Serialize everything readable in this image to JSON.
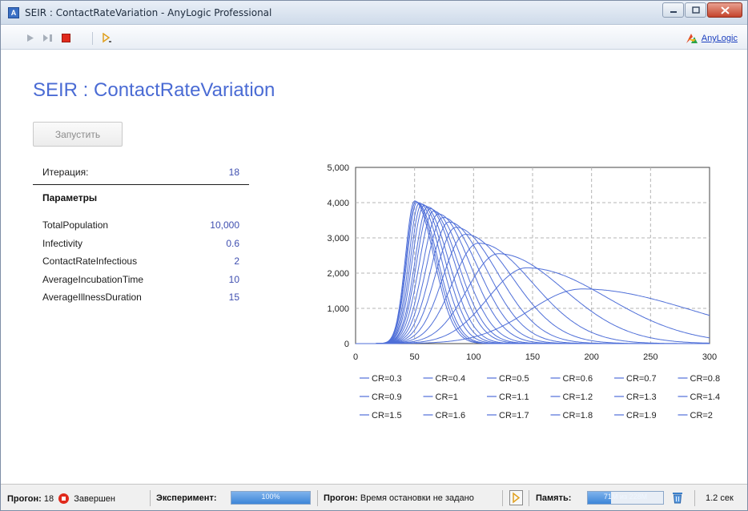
{
  "window": {
    "title": "SEIR : ContactRateVariation - AnyLogic Professional",
    "app_icon_glyph": "A",
    "controls": [
      "minimize",
      "maximize",
      "close"
    ]
  },
  "toolbar": {
    "buttons": [
      "run-icon",
      "step-icon",
      "stop-icon",
      "run-until-icon"
    ],
    "brand_label": "AnyLogic"
  },
  "page": {
    "title": "SEIR : ContactRateVariation",
    "run_button": "Запустить"
  },
  "iteration": {
    "label": "Итерация:",
    "value": "18"
  },
  "params": {
    "heading": "Параметры",
    "rows": [
      {
        "name": "TotalPopulation",
        "value": "10,000"
      },
      {
        "name": "Infectivity",
        "value": "0.6"
      },
      {
        "name": "ContactRateInfectious",
        "value": "2"
      },
      {
        "name": "AverageIncubationTime",
        "value": "10"
      },
      {
        "name": "AverageIllnessDuration",
        "value": "15"
      }
    ]
  },
  "chart_data": {
    "type": "line",
    "title": "",
    "xlabel": "",
    "ylabel": "",
    "xlim": [
      0,
      300
    ],
    "ylim": [
      0,
      5000
    ],
    "xticks": [
      "0",
      "50",
      "100",
      "150",
      "200",
      "250",
      "300"
    ],
    "yticks": [
      "0",
      "1,000",
      "2,000",
      "3,000",
      "4,000",
      "5,000"
    ],
    "grid": true,
    "legend_position": "bottom",
    "line_color": "#4f6fd8",
    "series": [
      {
        "name": "CR=0.3",
        "peak_x": 192,
        "peak_y": 1550
      },
      {
        "name": "CR=0.4",
        "peak_x": 145,
        "peak_y": 2150
      },
      {
        "name": "CR=0.5",
        "peak_x": 121,
        "peak_y": 2550
      },
      {
        "name": "CR=0.6",
        "peak_x": 104,
        "peak_y": 2850
      },
      {
        "name": "CR=0.7",
        "peak_x": 93,
        "peak_y": 3100
      },
      {
        "name": "CR=0.8",
        "peak_x": 85,
        "peak_y": 3300
      },
      {
        "name": "CR=0.9",
        "peak_x": 79,
        "peak_y": 3450
      },
      {
        "name": "CR=1",
        "peak_x": 74,
        "peak_y": 3580
      },
      {
        "name": "CR=1.1",
        "peak_x": 70,
        "peak_y": 3680
      },
      {
        "name": "CR=1.2",
        "peak_x": 66,
        "peak_y": 3760
      },
      {
        "name": "CR=1.3",
        "peak_x": 63,
        "peak_y": 3830
      },
      {
        "name": "CR=1.4",
        "peak_x": 61,
        "peak_y": 3880
      },
      {
        "name": "CR=1.5",
        "peak_x": 58,
        "peak_y": 3920
      },
      {
        "name": "CR=1.6",
        "peak_x": 56,
        "peak_y": 3960
      },
      {
        "name": "CR=1.7",
        "peak_x": 54,
        "peak_y": 3990
      },
      {
        "name": "CR=1.8",
        "peak_x": 52,
        "peak_y": 4010
      },
      {
        "name": "CR=1.9",
        "peak_x": 51,
        "peak_y": 4030
      },
      {
        "name": "CR=2",
        "peak_x": 50,
        "peak_y": 4050
      }
    ]
  },
  "status": {
    "run_label": "Прогон:",
    "run_value": "18",
    "run_state": "Завершен",
    "experiment_label": "Эксперимент:",
    "experiment_progress_text": "100%",
    "experiment_progress": 1.0,
    "stop_label": "Прогон:",
    "stop_text": "Время остановки не задано",
    "memory_label": "Память:",
    "memory_text": "71M из 228M",
    "memory_fraction": 0.31,
    "elapsed": "1.2 сек"
  }
}
